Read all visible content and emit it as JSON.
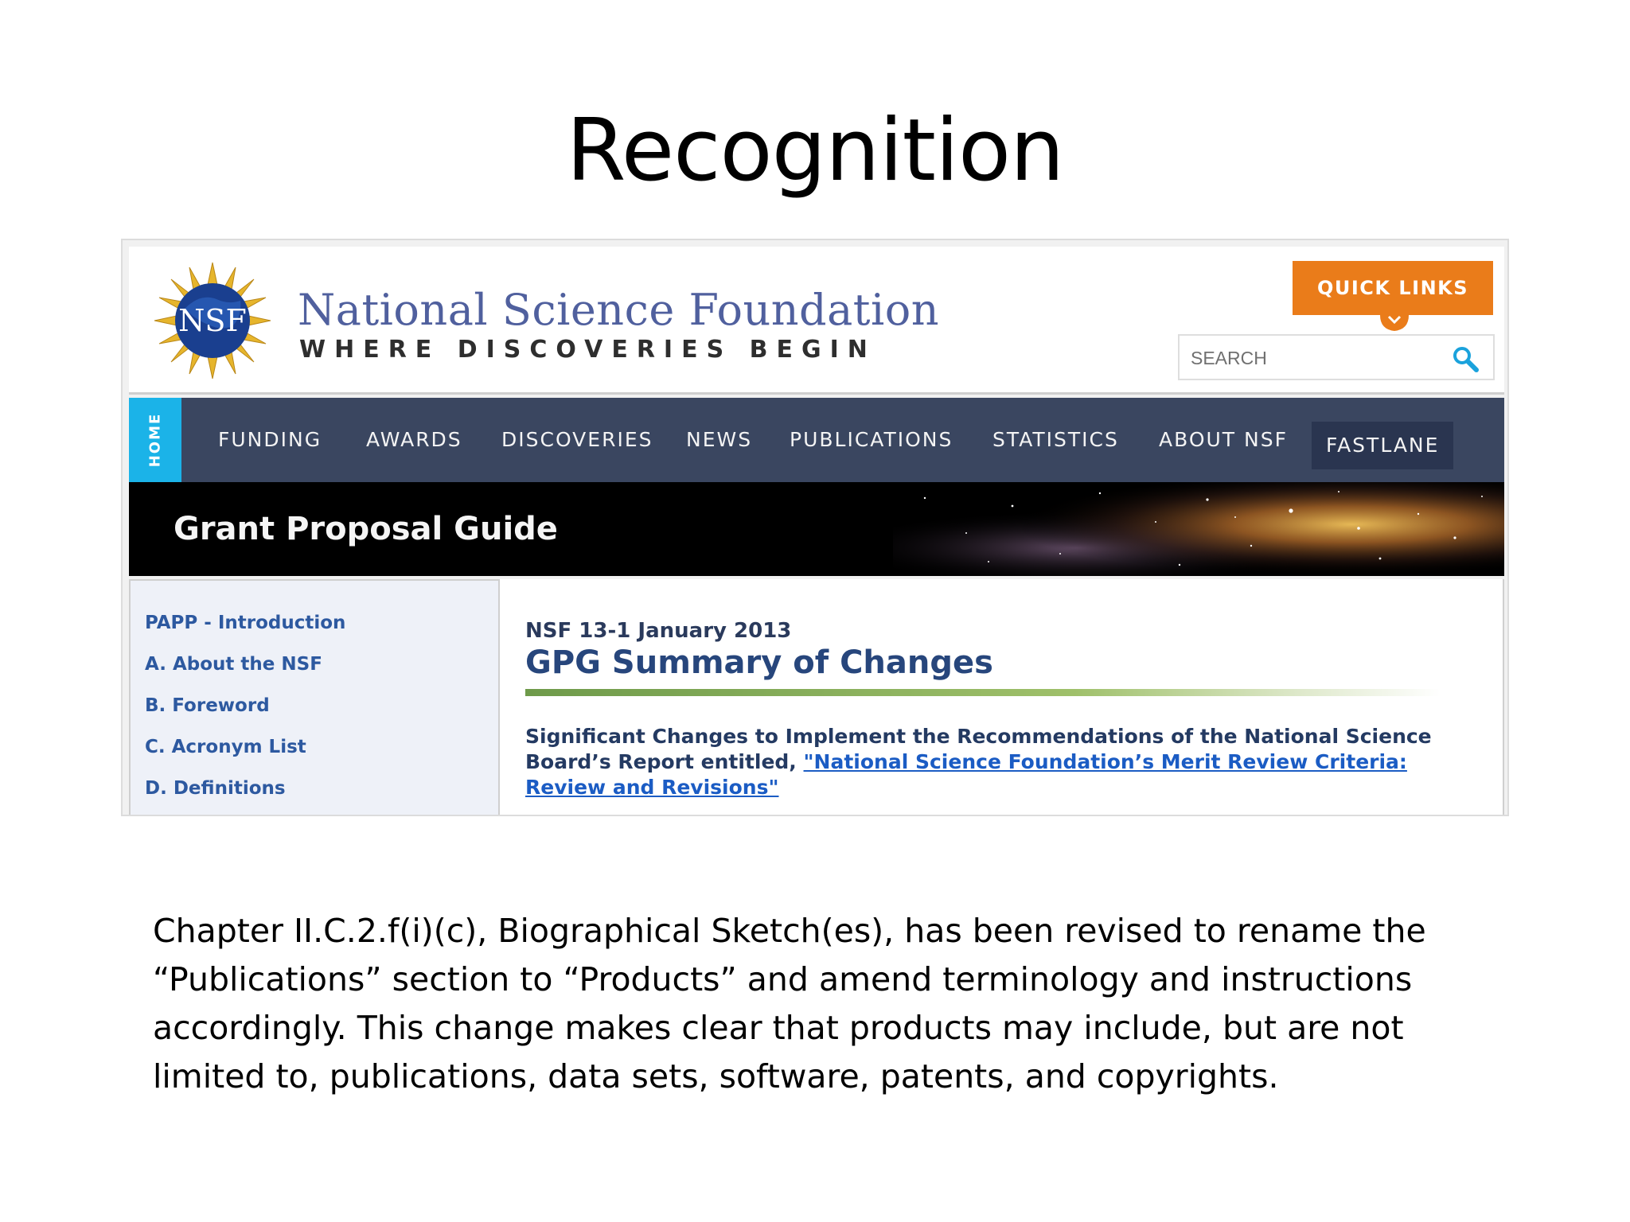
{
  "slide": {
    "title": "Recognition",
    "body": "Chapter II.C.2.f(i)(c), Biographical Sketch(es), has been revised to rename the “Publications” section to “Products” and amend terminology and instructions accordingly. This change makes clear that products may include, but are not limited to, publications, data sets, software, patents, and copyrights."
  },
  "site": {
    "logo_text": "NSF",
    "name": "National Science Foundation",
    "tagline": "WHERE DISCOVERIES BEGIN",
    "quick_links": "QUICK LINKS",
    "search_placeholder": "SEARCH",
    "home_tab": "HOME",
    "nav": [
      "FUNDING",
      "AWARDS",
      "DISCOVERIES",
      "NEWS",
      "PUBLICATIONS",
      "STATISTICS",
      "ABOUT NSF",
      "FASTLANE"
    ],
    "banner_title": "Grant Proposal Guide",
    "left_nav": [
      "PAPP - Introduction",
      "A. About the NSF",
      "B. Foreword",
      "C. Acronym List",
      "D. Definitions"
    ],
    "doc_id": "NSF 13-1 January 2013",
    "doc_title": "GPG Summary of Changes",
    "summary_text": "Significant Changes to Implement the Recommendations of the National Science Board’s Report entitled,",
    "summary_link": "\"National Science Foundation’s Merit Review Criteria: Review and Revisions\""
  },
  "colors": {
    "brand_blue": "#50609e",
    "quick_links_orange": "#ea7c1a",
    "nav_bar": "#3a4660",
    "home_tab": "#1bb3e8",
    "link_blue": "#2d59a0",
    "title_rule_green": "#9fc06a"
  },
  "icons": {
    "logo": "nsf-globe-seal-icon",
    "search": "search-icon",
    "chevron": "chevron-down-icon"
  }
}
